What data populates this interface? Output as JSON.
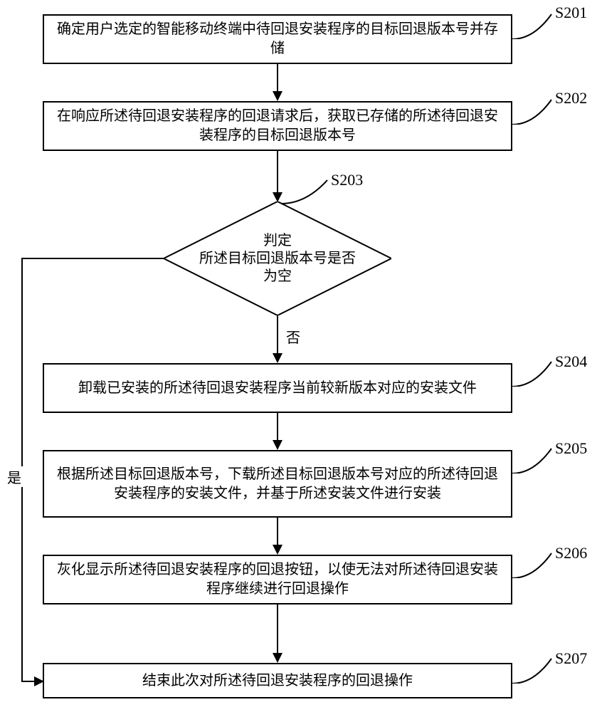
{
  "steps": {
    "s201": {
      "label": "S201",
      "text": "确定用户选定的智能移动终端中待回退安装程序的目标回退版本号并存储"
    },
    "s202": {
      "label": "S202",
      "text": "在响应所述待回退安装程序的回退请求后，获取已存储的所述待回退安装程序的目标回退版本号"
    },
    "s203": {
      "label": "S203",
      "text": "判定\n所述目标回退版本号是否\n为空"
    },
    "s204": {
      "label": "S204",
      "text": "卸载已安装的所述待回退安装程序当前较新版本对应的安装文件"
    },
    "s205": {
      "label": "S205",
      "text": "根据所述目标回退版本号，下载所述目标回退版本号对应的所述待回退安装程序的安装文件，并基于所述安装文件进行安装"
    },
    "s206": {
      "label": "S206",
      "text": "灰化显示所述待回退安装程序的回退按钮，以使无法对所述待回退安装程序继续进行回退操作"
    },
    "s207": {
      "label": "S207",
      "text": "结束此次对所述待回退安装程序的回退操作"
    }
  },
  "edges": {
    "no": "否",
    "yes": "是"
  }
}
